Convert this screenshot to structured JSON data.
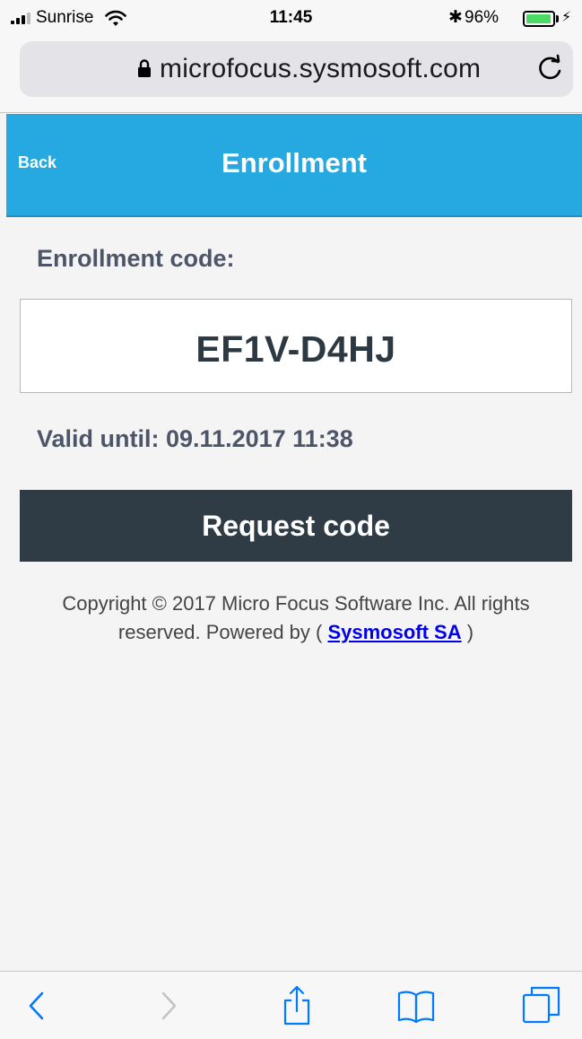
{
  "status_bar": {
    "carrier": "Sunrise",
    "time": "11:45",
    "bluetooth": "✱",
    "battery_percent": "96%",
    "battery_level": 0.96
  },
  "browser": {
    "url": "microfocus.sysmosoft.com"
  },
  "header": {
    "back_label": "Back",
    "title": "Enrollment"
  },
  "main": {
    "enrollment_label": "Enrollment code:",
    "code": "EF1V-D4HJ",
    "valid_until": "Valid until: 09.11.2017 11:38",
    "request_button": "Request code"
  },
  "footer": {
    "copyright_text": "Copyright © 2017 Micro Focus Software Inc. All rights reserved. Powered by (",
    "link_text": "Sysmosoft SA",
    "closing": ")"
  },
  "colors": {
    "header_bg": "#25a9e0",
    "button_bg": "#2f3c45",
    "ios_blue": "#007aff"
  },
  "toolbar": {
    "icons": [
      "back-icon",
      "forward-icon",
      "share-icon",
      "bookmarks-icon",
      "tabs-icon"
    ]
  }
}
